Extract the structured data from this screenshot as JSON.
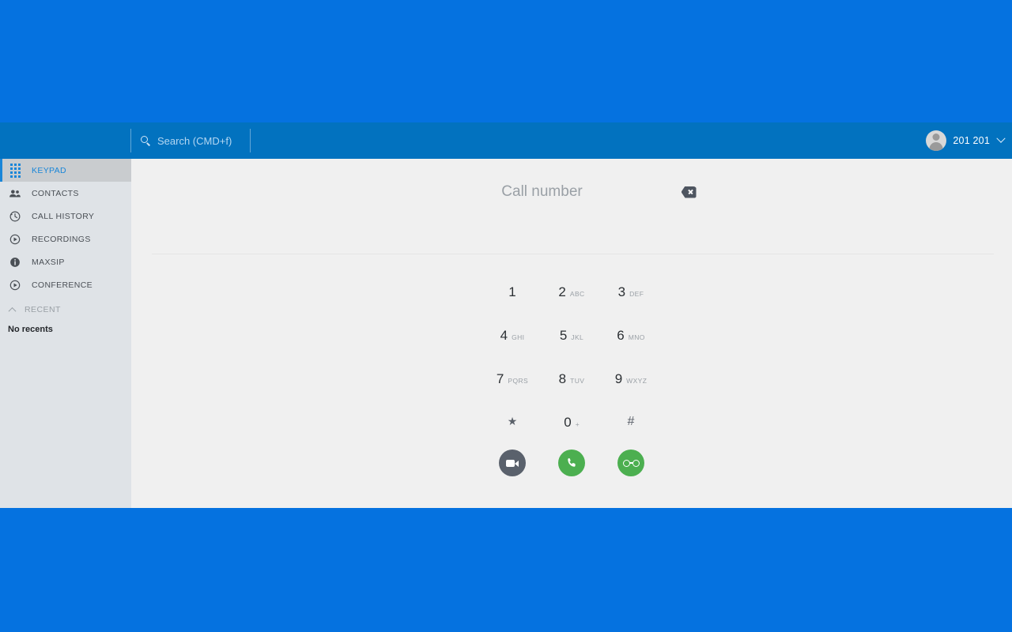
{
  "app": {
    "accent_blue": "#0572e0",
    "header_blue": "#0272bf",
    "sidebar_bg": "#dfe3e7",
    "panel_bg": "#f0f0f0",
    "call_green": "#4caf50",
    "video_gray": "#5a616c",
    "active_text": "#1a86d8"
  },
  "header": {
    "search": {
      "placeholder": "Search (CMD+f)",
      "value": "",
      "icon": "search-icon"
    },
    "user": {
      "name": "201 201",
      "avatar_icon": "avatar-person-icon",
      "chevron_icon": "chevron-down-icon"
    }
  },
  "sidebar": {
    "items": [
      {
        "label": "KEYPAD",
        "icon": "keypad-icon",
        "active": true
      },
      {
        "label": "CONTACTS",
        "icon": "contacts-icon",
        "active": false
      },
      {
        "label": "CALL HISTORY",
        "icon": "call-history-icon",
        "active": false
      },
      {
        "label": "RECORDINGS",
        "icon": "recordings-icon",
        "active": false
      },
      {
        "label": "MAXSIP",
        "icon": "info-icon",
        "active": false
      },
      {
        "label": "CONFERENCE",
        "icon": "conference-icon",
        "active": false
      }
    ],
    "recent": {
      "label": "RECENT",
      "chevron_icon": "chevron-up-icon",
      "empty_text": "No recents"
    }
  },
  "dialer": {
    "number_placeholder": "Call number",
    "number_value": "",
    "backspace_icon": "backspace-icon",
    "keys": [
      [
        {
          "digit": "1",
          "letters": ""
        },
        {
          "digit": "2",
          "letters": "ABC"
        },
        {
          "digit": "3",
          "letters": "DEF"
        }
      ],
      [
        {
          "digit": "4",
          "letters": "GHI"
        },
        {
          "digit": "5",
          "letters": "JKL"
        },
        {
          "digit": "6",
          "letters": "MNO"
        }
      ],
      [
        {
          "digit": "7",
          "letters": "PQRS"
        },
        {
          "digit": "8",
          "letters": "TUV"
        },
        {
          "digit": "9",
          "letters": "WXYZ"
        }
      ],
      [
        {
          "digit": "★",
          "letters": ""
        },
        {
          "digit": "0",
          "letters": "+"
        },
        {
          "digit": "#",
          "letters": ""
        }
      ]
    ],
    "actions": [
      {
        "name": "video-call-button",
        "icon": "video-camera-icon",
        "color": "#5a616c"
      },
      {
        "name": "audio-call-button",
        "icon": "phone-icon",
        "color": "#4caf50"
      },
      {
        "name": "voicemail-button",
        "icon": "voicemail-icon",
        "color": "#4caf50"
      }
    ]
  }
}
